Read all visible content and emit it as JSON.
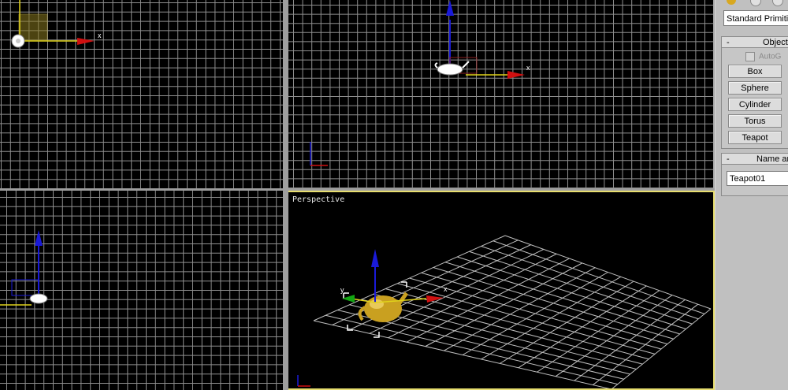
{
  "viewports": {
    "perspective": {
      "label": "Perspective"
    }
  },
  "axes": {
    "x": "x",
    "y": "y"
  },
  "panel": {
    "category_dropdown": "Standard Primitiv",
    "object_type_rollout": {
      "toggle": "-",
      "title": "Object"
    },
    "autogrid_label": "AutoG",
    "object_buttons": [
      "Box",
      "Sphere",
      "Cylinder",
      "Torus",
      "Teapot"
    ],
    "name_rollout": {
      "toggle": "-",
      "title": "Name ar"
    },
    "name_value": "Teapot01"
  },
  "colors": {
    "grid": "#8f8f8f",
    "active_border": "#e6dd6e",
    "x_axis": "#d01010",
    "y_axis": "#13a613",
    "z_axis": "#1a1ad8",
    "teapot": "#c9a020"
  }
}
